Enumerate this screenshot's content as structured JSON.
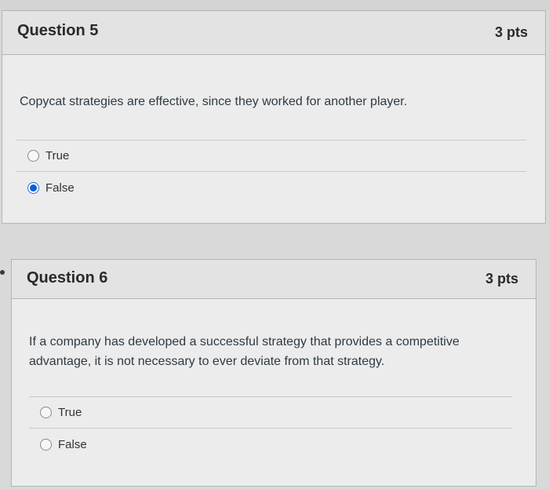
{
  "questions": [
    {
      "title": "Question 5",
      "points": "3 pts",
      "text": "Copycat strategies are effective, since they worked for another player.",
      "options": [
        {
          "label": "True",
          "selected": false
        },
        {
          "label": "False",
          "selected": true
        }
      ]
    },
    {
      "title": "Question 6",
      "points": "3 pts",
      "text": "If a company has developed a successful strategy that provides a competitive advantage, it is not necessary to ever deviate from that strategy.",
      "options": [
        {
          "label": "True",
          "selected": false
        },
        {
          "label": "False",
          "selected": false
        }
      ]
    }
  ],
  "colors": {
    "selected_radio": "#0b5fd9",
    "header_bg": "#e3e3e3",
    "card_bg": "#ececec"
  }
}
